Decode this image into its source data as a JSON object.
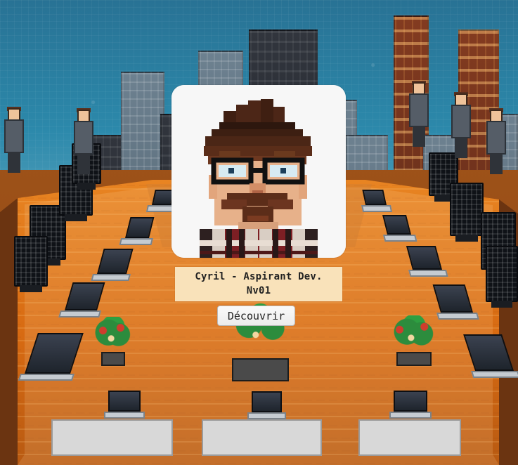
{
  "profile": {
    "name_line_1": "Cyril - Aspirant Dev.",
    "name_line_2": "Nv01",
    "button_label": "Découvrir"
  }
}
